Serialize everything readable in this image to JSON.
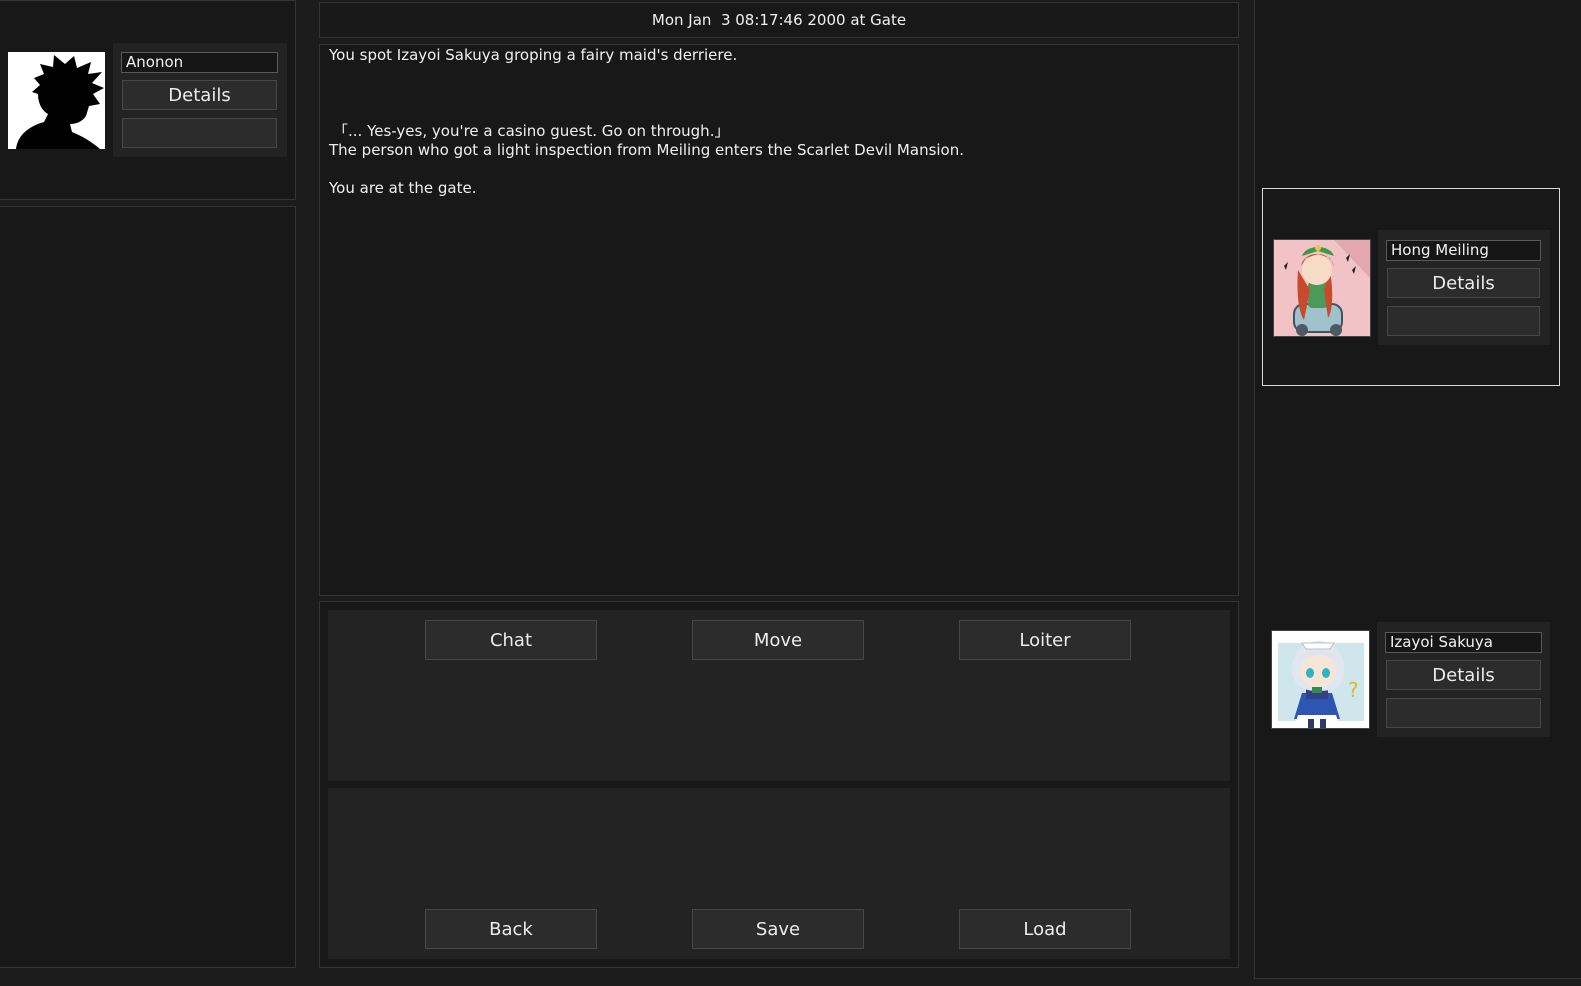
{
  "header": {
    "datetime": "Mon Jan  3 08:17:46 2000 at Gate"
  },
  "player": {
    "name": "Anonon",
    "details_label": "Details",
    "portrait_icon": "silhouette-icon"
  },
  "log": {
    "lines": [
      "You spot Izayoi Sakuya groping a fairy maid's derriere.",
      "",
      "",
      "",
      "「... Yes-yes, you're a casino guest. Go on through.」",
      "The person who got a light inspection from Meiling enters the Scarlet Devil Mansion.",
      "",
      "You are at the gate."
    ]
  },
  "actions": {
    "chat": "Chat",
    "move": "Move",
    "loiter": "Loiter"
  },
  "system": {
    "back": "Back",
    "save": "Save",
    "load": "Load"
  },
  "npcs": [
    {
      "name": "Hong Meiling",
      "details_label": "Details",
      "portrait_icon": "hong-meiling-portrait"
    },
    {
      "name": "Izayoi Sakuya",
      "details_label": "Details",
      "portrait_icon": "izayoi-sakuya-portrait"
    }
  ]
}
